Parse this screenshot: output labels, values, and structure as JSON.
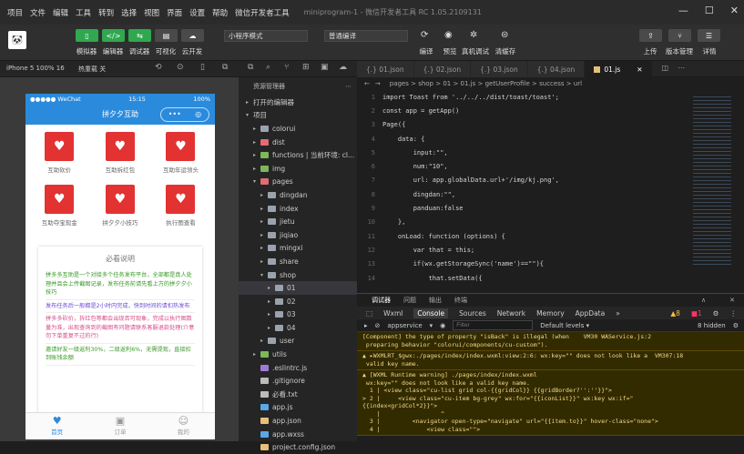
{
  "menubar": {
    "items": [
      "项目",
      "文件",
      "编辑",
      "工具",
      "转到",
      "选择",
      "视图",
      "界面",
      "设置",
      "帮助",
      "微信开发者工具"
    ],
    "title": "miniprogram-1 - 微信开发者工具 RC 1.05.2109131"
  },
  "toolbar": {
    "buttons": [
      "模拟器",
      "编辑器",
      "调试器",
      "可视化",
      "云开发"
    ],
    "mode": "小程序模式",
    "compile": "普通编译",
    "compile_labels": [
      "编译",
      "预览",
      "真机调试",
      "清缓存"
    ],
    "right_labels": [
      "上传",
      "版本管理",
      "详情"
    ]
  },
  "device_bar": {
    "device": "iPhone 5 100% 16",
    "hotreload": "热重载 关"
  },
  "phone": {
    "carrier": "●●●●● WeChat",
    "time": "15:15",
    "battery": "100%",
    "title": "拼夕夕互助",
    "grid": [
      {
        "label": "互助砍价"
      },
      {
        "label": "互助拆红包"
      },
      {
        "label": "互助年运领头"
      },
      {
        "label": "互助夺宝现金"
      },
      {
        "label": "拼夕夕小技巧"
      },
      {
        "label": "执行图查看"
      }
    ],
    "notice_title": "必看说明",
    "notice": [
      {
        "text": "拼多多互助是一个对接多个任务发布平台，全部都是真人处理并且会上传截图记录，发布任务前请先看上方的拼夕夕小技巧",
        "color": "#3a9a2a"
      },
      {
        "text": "发布任务后一般都是2小时内完成，快到时间的请扣热发布",
        "color": "#6b4bd6"
      },
      {
        "text": "拼多多砍价，拆红包等都会出现否可现象，完成以执行图数量为准，出现查询到的截图有问题请联系客服退款处理(介意勿下单重复不过的行)",
        "color": "#d94a8a"
      },
      {
        "text": "邀请好友一级返利30%，二级返利6%，无需提现，直接扣到账钱余额",
        "color": "#3a9a2a"
      }
    ],
    "tabs": [
      "首页",
      "订单",
      "我的"
    ]
  },
  "explorer": {
    "title": "资源管理器",
    "open_editors": "打开的编辑器",
    "root": "项目",
    "items": [
      {
        "label": "colorui",
        "depth": 1,
        "type": "folder",
        "arrow": "▸"
      },
      {
        "label": "dist",
        "depth": 1,
        "type": "folder-red",
        "arrow": "▸"
      },
      {
        "label": "functions | 当前环境: cl...",
        "depth": 1,
        "type": "folder-green",
        "arrow": "▸"
      },
      {
        "label": "img",
        "depth": 1,
        "type": "folder-green",
        "arrow": "▸"
      },
      {
        "label": "pages",
        "depth": 1,
        "type": "folder-red",
        "arrow": "▾"
      },
      {
        "label": "dingdan",
        "depth": 2,
        "type": "folder",
        "arrow": "▸"
      },
      {
        "label": "index",
        "depth": 2,
        "type": "folder",
        "arrow": "▸"
      },
      {
        "label": "jietu",
        "depth": 2,
        "type": "folder",
        "arrow": "▸"
      },
      {
        "label": "jiqiao",
        "depth": 2,
        "type": "folder",
        "arrow": "▸"
      },
      {
        "label": "mingxi",
        "depth": 2,
        "type": "folder",
        "arrow": "▸"
      },
      {
        "label": "share",
        "depth": 2,
        "type": "folder",
        "arrow": "▸"
      },
      {
        "label": "shop",
        "depth": 2,
        "type": "folder",
        "arrow": "▾"
      },
      {
        "label": "01",
        "depth": 3,
        "type": "folder",
        "arrow": "▸",
        "selected": true
      },
      {
        "label": "02",
        "depth": 3,
        "type": "folder",
        "arrow": "▸"
      },
      {
        "label": "03",
        "depth": 3,
        "type": "folder",
        "arrow": "▸"
      },
      {
        "label": "04",
        "depth": 3,
        "type": "folder",
        "arrow": "▸"
      },
      {
        "label": "user",
        "depth": 2,
        "type": "folder",
        "arrow": "▸"
      },
      {
        "label": "utils",
        "depth": 1,
        "type": "folder-green",
        "arrow": "▸"
      },
      {
        "label": ".eslintrc.js",
        "depth": 1,
        "type": "file-purple",
        "arrow": ""
      },
      {
        "label": ".gitignore",
        "depth": 1,
        "type": "file-grey",
        "arrow": ""
      },
      {
        "label": "必看.txt",
        "depth": 1,
        "type": "file-grey",
        "arrow": ""
      },
      {
        "label": "app.js",
        "depth": 1,
        "type": "file-blue",
        "arrow": ""
      },
      {
        "label": "app.json",
        "depth": 1,
        "type": "file-yellow",
        "arrow": ""
      },
      {
        "label": "app.wxss",
        "depth": 1,
        "type": "file-blue",
        "arrow": ""
      },
      {
        "label": "project.config.json",
        "depth": 1,
        "type": "file-yellow",
        "arrow": ""
      }
    ]
  },
  "editor": {
    "tabs": [
      "{.} 01.json",
      "{.} 02.json",
      "{.} 03.json",
      "{.} 04.json",
      "01.js"
    ],
    "breadcrumb": "pages > shop > 01 > 01.js > getUserProfile > success > url",
    "lines": [
      "import Toast from '../../../dist/toast/toast';",
      "const app = getApp()",
      "Page({",
      "    data: {",
      "        input:\"\",",
      "        num:\"10\",",
      "        url: app.globalData.url+'/img/kj.png',",
      "        dingdan:\"\",",
      "        panduan:false",
      "    },",
      "    onLoad: function (options) {",
      "        var that = this;",
      "        if(wx.getStorageSync('name')==\"\"){",
      "            that.setData({"
    ]
  },
  "debug": {
    "panel_tabs": [
      "调试器",
      "问题",
      "输出",
      "终端"
    ],
    "devtools_tabs": [
      "Wxml",
      "Console",
      "Sources",
      "Network",
      "Memory",
      "AppData"
    ],
    "context": "appservice",
    "filter_placeholder": "Filter",
    "levels": "Default levels ▾",
    "warn_count": "8",
    "err_count": "1",
    "hidden": "8 hidden",
    "console": [
      "[Component] the type of property \"isBack\" is illegal (when    VM30 WAService.js:2\n preparing behavior \"colorui/components/cu-custom\").",
      "▲ ▸WXMLRT_$gwx:./pages/index/index.wxml:view:2:6: wx:key=\"\" does not look like a  VM307:18\n valid key name.",
      "▲ [WXML Runtime warning] ./pages/index/index.wxml\n wx:key=\"\" does not look like a valid key name.\n  1 | <view class=\"cu-list grid col-{{gridCol}} {{gridBorder?'':''}}\">\n> 2 |     <view class=\"cu-item bg-grey\" wx:for=\"{{iconList}}\" wx:key wx:if=\"\n{{index<gridCol*2}}\">\n    |                 ^\n  3 |         <navigator open-type=\"navigate\" url=\"{{item.to}}\" hover-class=\"none\">\n  4 |             <view class=\"\">"
    ]
  }
}
